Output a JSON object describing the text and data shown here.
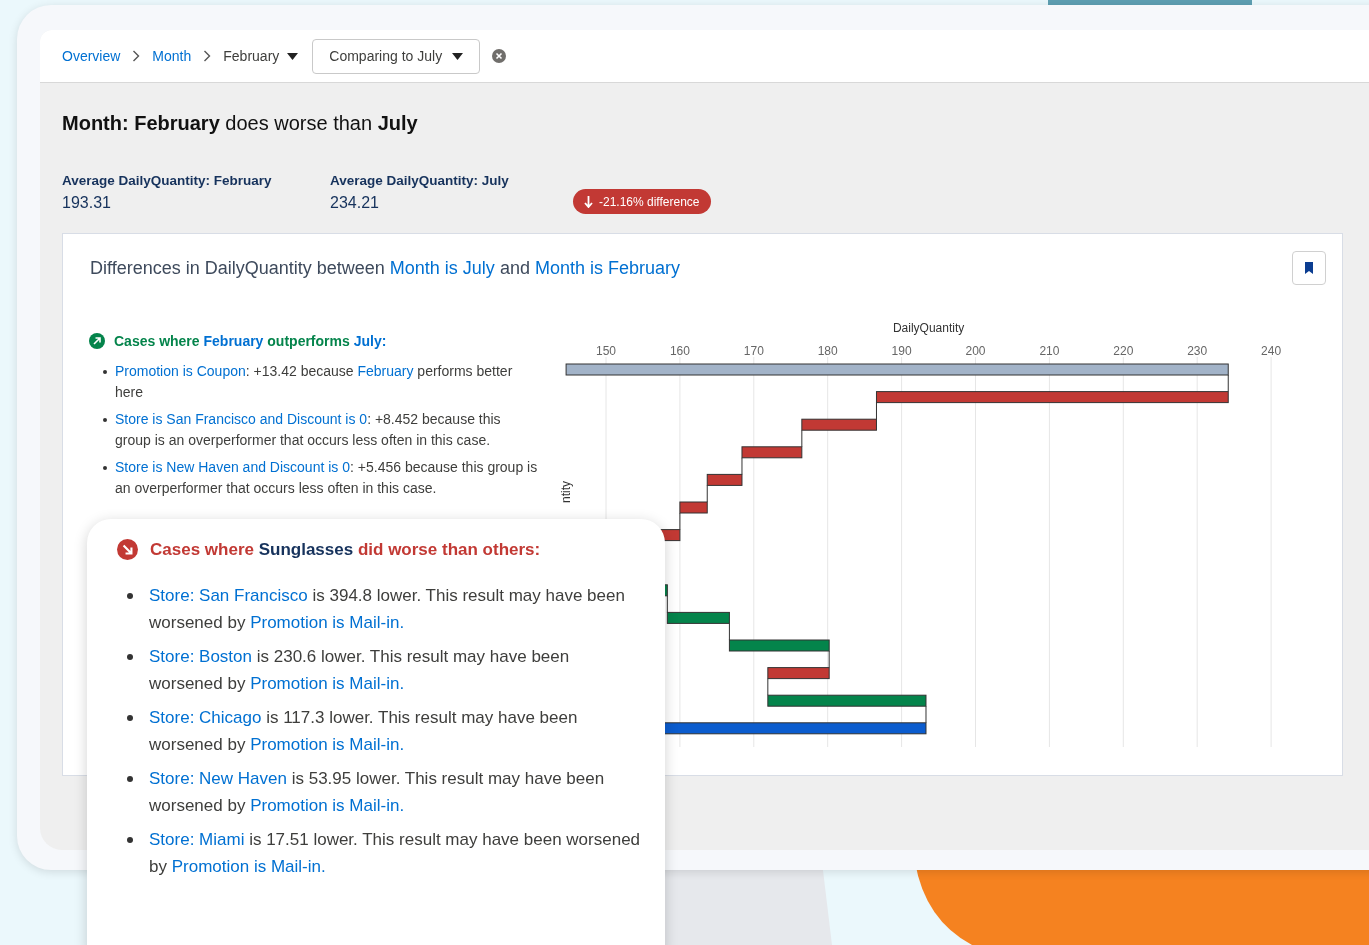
{
  "breadcrumbs": [
    {
      "label": "Overview",
      "kind": "link"
    },
    {
      "label": "Month",
      "kind": "link"
    },
    {
      "label": "February",
      "kind": "dropdown"
    }
  ],
  "compare_dropdown": {
    "label": "Comparing to July"
  },
  "headline": "**Month: February** does worse than **July**",
  "stats": [
    {
      "label": "Average DailyQuantity: February",
      "value": "193.31"
    },
    {
      "label": "Average DailyQuantity: July",
      "value": "234.21"
    }
  ],
  "difference_badge": {
    "text": "-21.16% difference",
    "decrease": true
  },
  "card": {
    "title": [
      {
        "kind": "plain",
        "text": "Differences in DailyQuantity between "
      },
      {
        "kind": "link",
        "text": "Month is July"
      },
      {
        "kind": "plain",
        "text": " and "
      },
      {
        "kind": "link",
        "text": "Month is February"
      }
    ],
    "chart": {
      "axis_title": "DailyQuantity",
      "axis_label": "ntity",
      "ticks": [
        "150",
        "160",
        "170",
        "180",
        "190",
        "200",
        "210",
        "220",
        "230",
        "240"
      ]
    }
  },
  "insights": [
    {
      "kind": "inline",
      "outperforms": true,
      "color": "#04844b",
      "heading": [
        {
          "kind": "plain",
          "text": "Cases where "
        },
        {
          "kind": "link",
          "text": "February"
        },
        {
          "kind": "plain",
          "text": " outperforms "
        },
        {
          "kind": "link",
          "text": "July:"
        }
      ],
      "items": [
        [
          {
            "kind": "link",
            "text": "Promotion is Coupon"
          },
          {
            "kind": "plain",
            "text": ": +13.42 because "
          },
          {
            "kind": "link",
            "text": "February"
          },
          {
            "kind": "plain",
            "text": " performs better here"
          }
        ],
        [
          {
            "kind": "link",
            "text": "Store is San Francisco and Discount is 0"
          },
          {
            "kind": "plain",
            "text": ": +8.452 because this group is an overperformer that occurs less often in this case."
          }
        ],
        [
          {
            "kind": "link",
            "text": "Store is New Haven and Discount is 0"
          },
          {
            "kind": "plain",
            "text": ": +5.456 because this group is an overperformer that occurs less often in this case."
          }
        ]
      ]
    },
    {
      "kind": "popout",
      "outperforms": false,
      "color": "#c23934",
      "heading": [
        {
          "kind": "plain",
          "text": "Cases where "
        },
        {
          "kind": "emphasis",
          "text": "Sunglasses"
        },
        {
          "kind": "plain",
          "text": " did worse than others:"
        }
      ],
      "items": [
        [
          {
            "kind": "link",
            "text": "Store: San Francisco"
          },
          {
            "kind": "plain",
            "text": " is 394.8 lower. This result may have been worsened by "
          },
          {
            "kind": "link",
            "text": "Promotion is Mail-in."
          }
        ],
        [
          {
            "kind": "link",
            "text": "Store: Boston"
          },
          {
            "kind": "plain",
            "text": " is 230.6 lower. This result may have been worsened by "
          },
          {
            "kind": "link",
            "text": "Promotion is Mail-in."
          }
        ],
        [
          {
            "kind": "link",
            "text": "Store: Chicago"
          },
          {
            "kind": "plain",
            "text": " is 117.3 lower. This result may have been worsened by "
          },
          {
            "kind": "link",
            "text": "Promotion is Mail-in."
          }
        ],
        [
          {
            "kind": "link",
            "text": "Store: New Haven"
          },
          {
            "kind": "plain",
            "text": " is 53.95 lower. This result may have been worsened by "
          },
          {
            "kind": "link",
            "text": "Promotion is Mail-in."
          }
        ],
        [
          {
            "kind": "link",
            "text": "Store: Miami"
          },
          {
            "kind": "plain",
            "text": " is 17.51 lower. This result may have been worsened by "
          },
          {
            "kind": "link",
            "text": "Promotion is Mail-in."
          }
        ]
      ]
    }
  ]
}
